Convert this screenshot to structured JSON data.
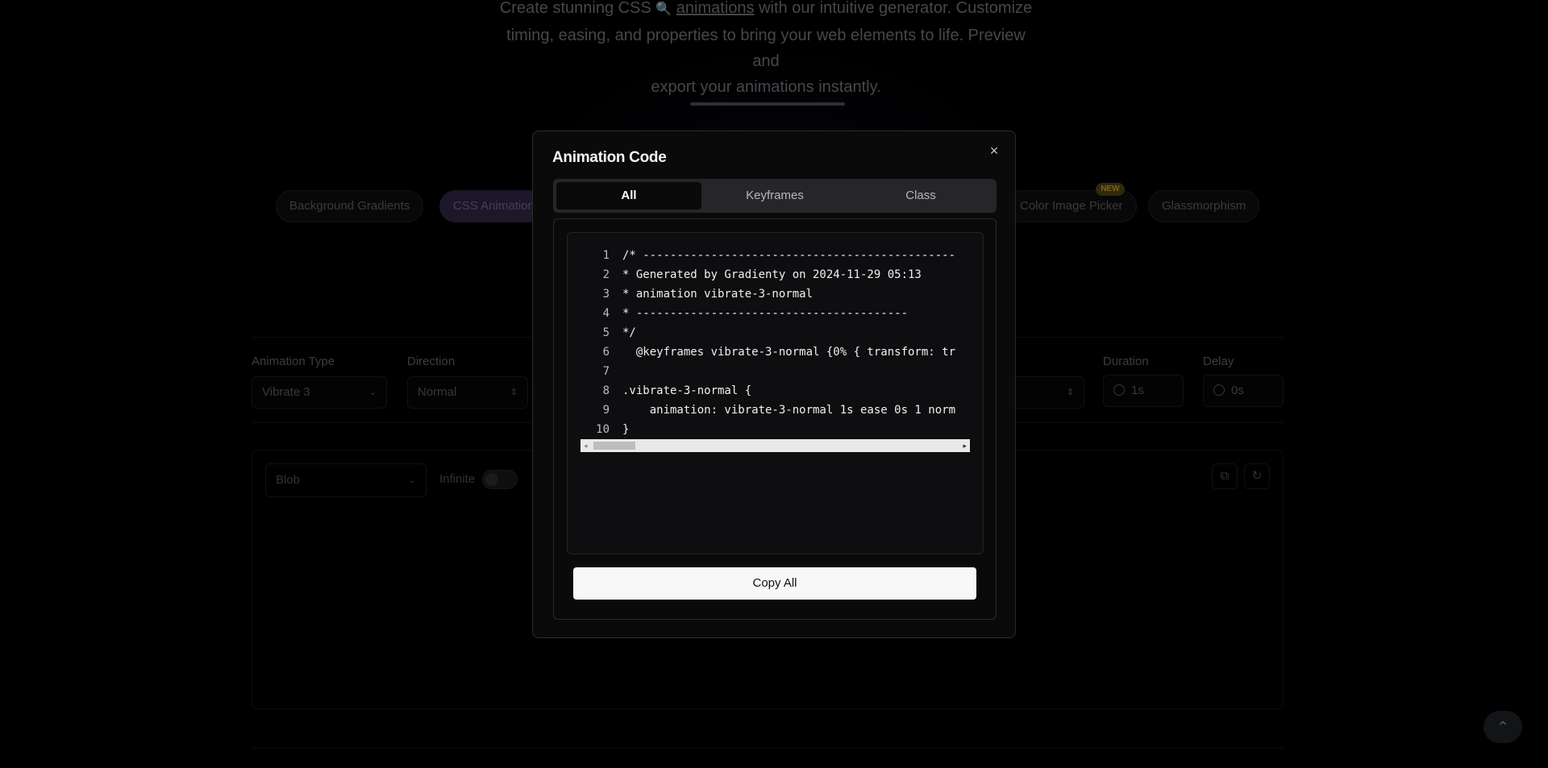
{
  "hero": {
    "text_1": "Create stunning CSS",
    "search_glyph": "🔍",
    "text_link": "animations",
    "text_2": "with our intuitive generator. Customize",
    "text_3": "timing, easing, and properties to bring your web elements to life. Preview and",
    "text_4": "export your animations instantly."
  },
  "nav_pills": [
    {
      "label": "Background Gradients"
    },
    {
      "label": "CSS Animations"
    },
    {
      "label": "Color Image Picker",
      "badge": "NEW"
    },
    {
      "label": "Glassmorphism"
    }
  ],
  "controls": {
    "animation_type_label": "Animation Type",
    "animation_type_value": "Vibrate 3",
    "direction_label": "Direction",
    "direction_value": "Normal",
    "duration_label": "Duration",
    "duration_value": "1s",
    "delay_label": "Delay",
    "delay_value": "0s"
  },
  "preview": {
    "shape_value": "Blob",
    "infinite_label": "Infinite"
  },
  "modal": {
    "title": "Animation Code",
    "close_glyph": "×",
    "tabs": [
      {
        "label": "All",
        "active": true
      },
      {
        "label": "Keyframes",
        "active": false
      },
      {
        "label": "Class",
        "active": false
      }
    ],
    "code_lines": [
      {
        "n": "1",
        "text": "/* ----------------------------------------------"
      },
      {
        "n": "2",
        "text": "* Generated by Gradienty on 2024-11-29 05:13"
      },
      {
        "n": "3",
        "text": "* animation vibrate-3-normal"
      },
      {
        "n": "4",
        "text": "* ----------------------------------------"
      },
      {
        "n": "5",
        "text": "*/"
      },
      {
        "n": "6",
        "text": "  @keyframes vibrate-3-normal {0% { transform: tr"
      },
      {
        "n": "7",
        "text": ""
      },
      {
        "n": "8",
        "text": ".vibrate-3-normal {"
      },
      {
        "n": "9",
        "text": "    animation: vibrate-3-normal 1s ease 0s 1 norm"
      },
      {
        "n": "10",
        "text": "}"
      }
    ],
    "copy_label": "Copy All"
  },
  "icons": {
    "chevron": "⌄",
    "up_down": "⇕",
    "copy": "⧉",
    "reset": "↻",
    "scroll_up": "⌃",
    "arrow_left": "◂",
    "arrow_right": "▸"
  }
}
